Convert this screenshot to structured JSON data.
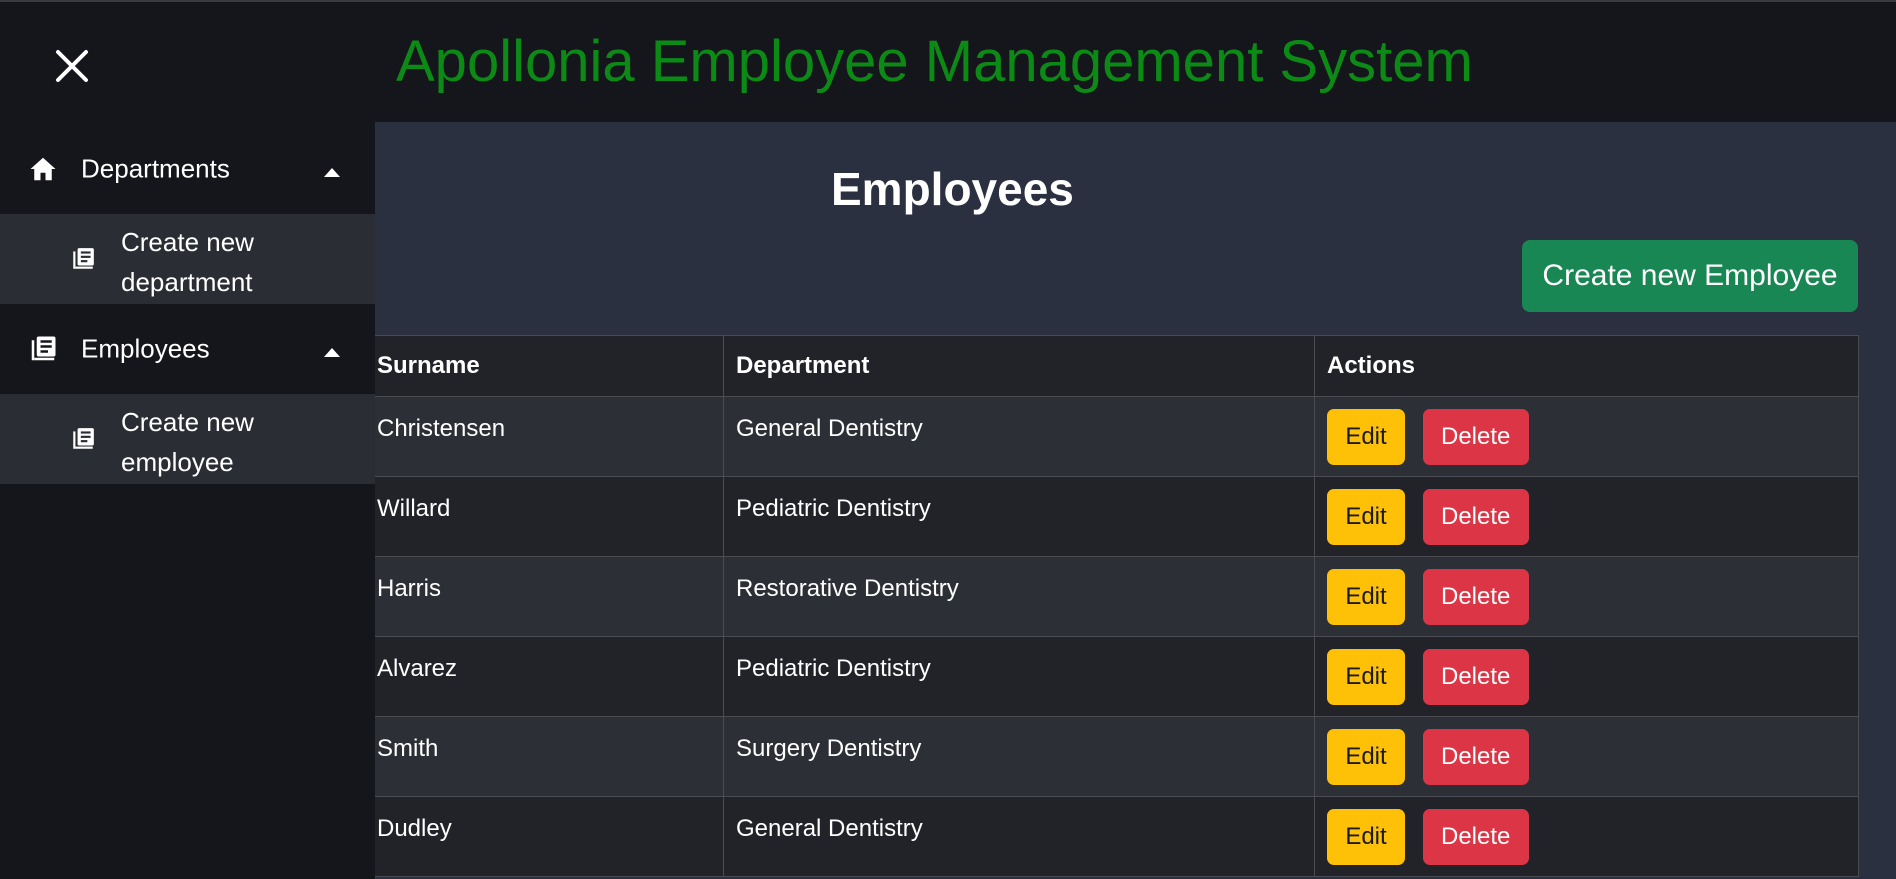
{
  "app": {
    "title": "Apollonia Employee Management System"
  },
  "sidebar": {
    "groups": [
      {
        "label": "Departments",
        "icon": "home-icon",
        "sub_label": "Create new department"
      },
      {
        "label": "Employees",
        "icon": "list-icon",
        "sub_label": "Create new employee"
      }
    ]
  },
  "main": {
    "title": "Employees",
    "create_label": "Create new Employee",
    "table": {
      "headers": [
        "Surname",
        "Department",
        "Actions"
      ],
      "rows": [
        {
          "surname": "Christensen",
          "department": "General Dentistry"
        },
        {
          "surname": "Willard",
          "department": "Pediatric Dentistry"
        },
        {
          "surname": "Harris",
          "department": "Restorative Dentistry"
        },
        {
          "surname": "Alvarez",
          "department": "Pediatric Dentistry"
        },
        {
          "surname": "Smith",
          "department": "Surgery Dentistry"
        },
        {
          "surname": "Dudley",
          "department": "General Dentistry"
        }
      ],
      "edit_label": "Edit",
      "delete_label": "Delete"
    }
  },
  "colors": {
    "title_green": "#0c8a16",
    "create_green": "#198754",
    "edit_yellow": "#ffc107",
    "delete_red": "#dc3545"
  }
}
